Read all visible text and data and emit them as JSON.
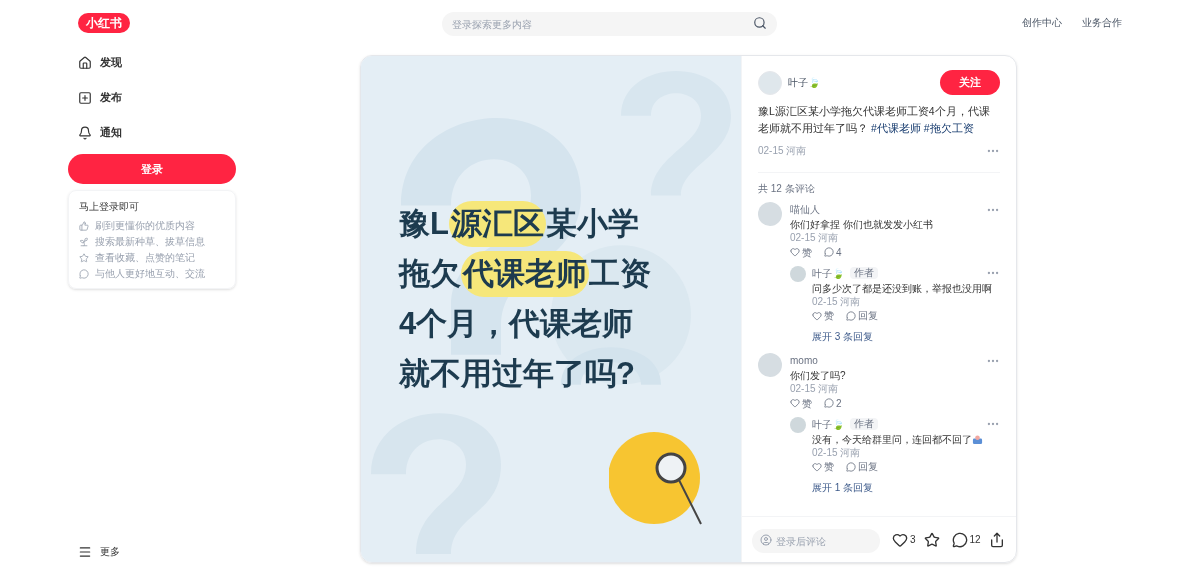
{
  "logo": "小红书",
  "search": {
    "placeholder": "登录探索更多内容"
  },
  "header_links": [
    "创作中心",
    "业务合作"
  ],
  "nav": [
    {
      "label": "发现",
      "kind": "home"
    },
    {
      "label": "发布",
      "kind": "plus"
    },
    {
      "label": "通知",
      "kind": "bell"
    }
  ],
  "login_button": "登录",
  "login_card": {
    "title": "马上登录即可",
    "items": [
      {
        "label": "刷到更懂你的优质内容",
        "kind": "thumb"
      },
      {
        "label": "搜索最新种草、拔草信息",
        "kind": "sprout"
      },
      {
        "label": "查看收藏、点赞的笔记",
        "kind": "star"
      },
      {
        "label": "与他人更好地互动、交流",
        "kind": "chat"
      }
    ]
  },
  "more": "更多",
  "cover": {
    "lines": [
      [
        {
          "text": "豫L",
          "highlight": false
        },
        {
          "text": "源汇区",
          "highlight": true
        },
        {
          "text": "某小学",
          "highlight": false
        }
      ],
      [
        {
          "text": "拖欠",
          "highlight": false
        },
        {
          "text": "代课老师",
          "highlight": true
        },
        {
          "text": "工资",
          "highlight": false
        }
      ],
      [
        {
          "text": "4个月，代课老师",
          "highlight": false
        }
      ],
      [
        {
          "text": "就不用过年了吗?",
          "highlight": false
        }
      ]
    ]
  },
  "author": {
    "name": "叶子🍃",
    "follow": "关注"
  },
  "post": {
    "text": "豫L源汇区某小学拖欠代课老师工资4个月，代课老师就不用过年了吗？",
    "tags": [
      "#代课老师",
      "#拖欠工资"
    ],
    "meta": "02-15 河南"
  },
  "comments_count": "共 12 条评论",
  "comments": [
    {
      "name": "喵仙人",
      "text": "你们好拿捏 你们也就发发小红书",
      "meta": "02-15 河南",
      "like": "赞",
      "reply_count": "4",
      "expand": "展开 3 条回复",
      "replies": [
        {
          "name": "叶子🍃",
          "badge": "作者",
          "text": "问多少次了都是还没到账，举报也没用啊",
          "emoji": false,
          "meta": "02-15 河南",
          "like": "赞",
          "reply": "回复"
        }
      ]
    },
    {
      "name": "momo",
      "text": "你们发了吗?",
      "meta": "02-15 河南",
      "like": "赞",
      "reply_count": "2",
      "expand": "展开 1 条回复",
      "replies": [
        {
          "name": "叶子🍃",
          "badge": "作者",
          "text": "没有，今天给群里问，连回都不回了",
          "emoji": true,
          "meta": "02-15 河南",
          "like": "赞",
          "reply": "回复"
        }
      ]
    }
  ],
  "footer": {
    "placeholder": "登录后评论",
    "likes": "3",
    "comments": "12"
  }
}
